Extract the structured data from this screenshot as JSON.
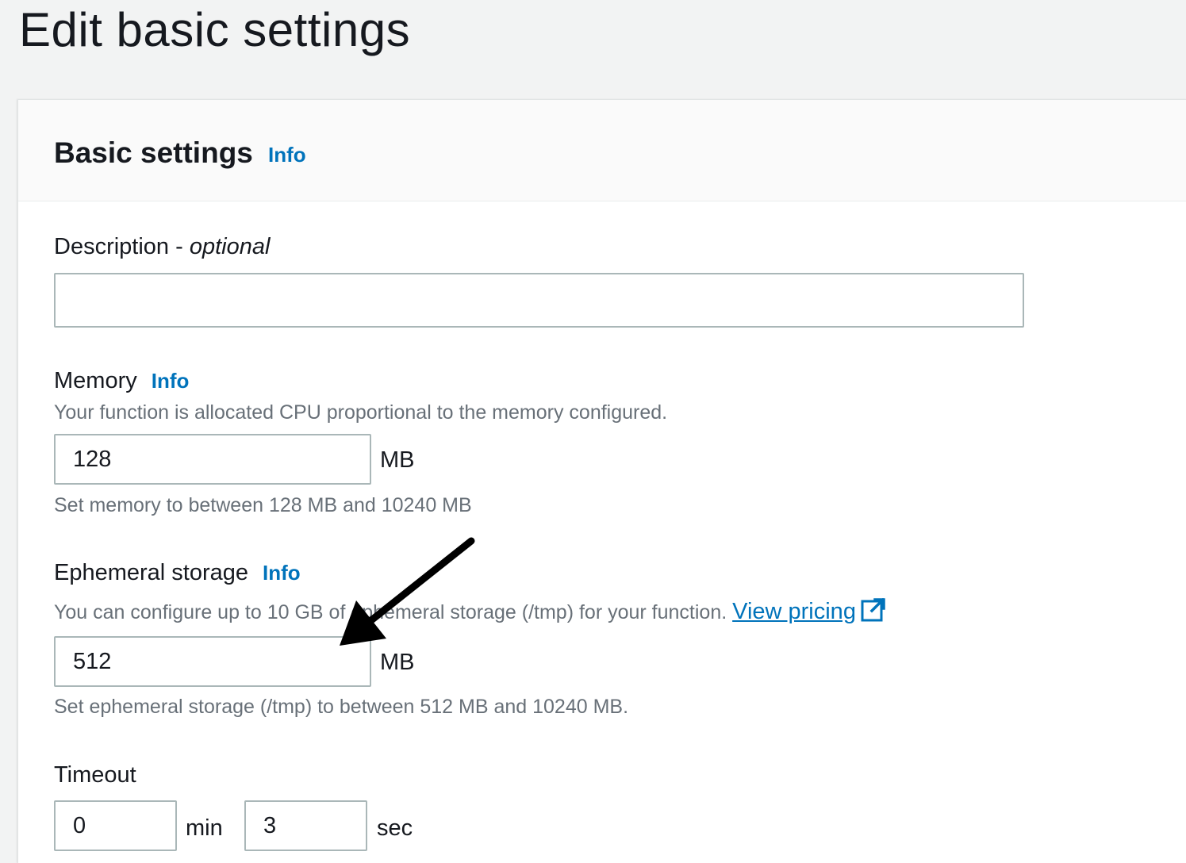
{
  "page": {
    "title": "Edit basic settings"
  },
  "panel": {
    "title": "Basic settings",
    "info": "Info"
  },
  "description": {
    "label": "Description - ",
    "label_optional": "optional",
    "value": ""
  },
  "memory": {
    "label": "Memory",
    "info": "Info",
    "help": "Your function is allocated CPU proportional to the memory configured.",
    "value": "128",
    "unit": "MB",
    "constraint": "Set memory to between 128 MB and 10240 MB"
  },
  "ephemeral": {
    "label": "Ephemeral storage",
    "info": "Info",
    "help": "You can configure up to 10 GB of ephemeral storage (/tmp) for your function.",
    "link": "View pricing",
    "value": "512",
    "unit": "MB",
    "constraint": "Set ephemeral storage (/tmp) to between 512 MB and 10240 MB."
  },
  "timeout": {
    "label": "Timeout",
    "min_value": "0",
    "min_unit": "min",
    "sec_value": "3",
    "sec_unit": "sec"
  },
  "icons": {
    "external_link": "external-link-icon",
    "annotation_arrow": "arrow-icon"
  },
  "colors": {
    "link": "#0073bb",
    "muted_text": "#687078",
    "border": "#aab7b8"
  }
}
